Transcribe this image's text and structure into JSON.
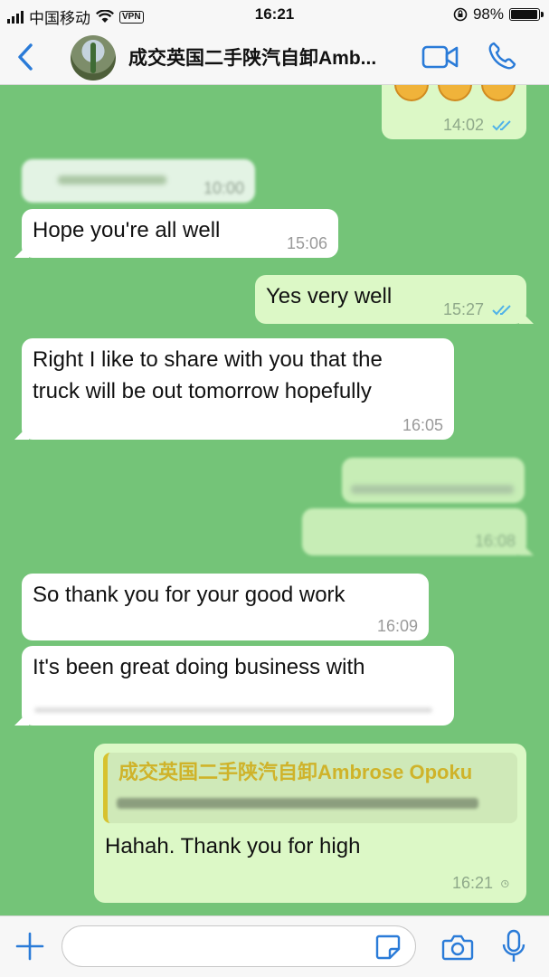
{
  "status_bar": {
    "carrier": "中国移动",
    "vpn": "VPN",
    "time": "16:21",
    "battery": "98%",
    "battery_level": 0.98
  },
  "header": {
    "contact_name": "成交英国二手陕汽自卸Amb..."
  },
  "messages": [
    {
      "time": "14:02"
    },
    {
      "time": "10:00"
    },
    {
      "text": "Hope you're all well",
      "time": "15:06"
    },
    {
      "text": "Yes very well",
      "time": "15:27"
    },
    {
      "text_line1": "Right I like to share with you that the",
      "text_line2": "truck will be out tomorrow hopefully",
      "time": "16:05"
    },
    {
      "time": "16:08"
    },
    {
      "text": "So thank you for your good work",
      "time": "16:09"
    },
    {
      "text": "It's been great doing business with"
    },
    {
      "quote_name": "成交英国二手陕汽自卸Ambrose Opoku",
      "text": "Hahah.  Thank you for high",
      "time": "16:21"
    }
  ],
  "colors": {
    "chat_background": "#74c478",
    "incoming": "#ffffff",
    "outgoing": "#dcf8c6",
    "accent": "#2a7bd8",
    "read_ticks": "#4fb2e8"
  },
  "icons": {
    "back": "chevron-left-icon",
    "video": "video-camera-icon",
    "call": "phone-icon",
    "plus": "plus-icon",
    "sticker": "sticker-icon",
    "camera": "camera-icon",
    "mic": "microphone-icon"
  }
}
